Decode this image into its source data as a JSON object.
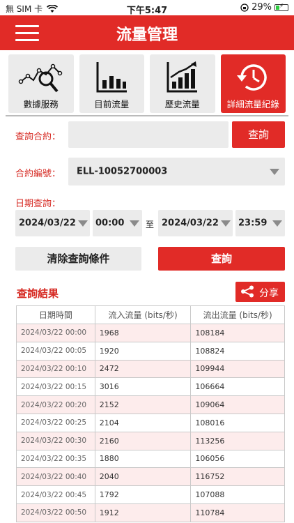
{
  "status_bar": {
    "carrier": "無 SIM 卡",
    "time": "下午5:47",
    "battery": "29%",
    "battery_level": 0.29
  },
  "header": {
    "title": "流量管理"
  },
  "tabs": [
    {
      "label": "數據服務",
      "icon": "analytics-search-icon",
      "active": false
    },
    {
      "label": "目前流量",
      "icon": "bar-chart-icon",
      "active": false
    },
    {
      "label": "歷史流量",
      "icon": "trend-chart-icon",
      "active": false
    },
    {
      "label": "詳細流量紀錄",
      "icon": "history-clock-icon",
      "active": true
    }
  ],
  "form": {
    "contract_query_label": "查詢合約：",
    "contract_query_value": "",
    "contract_query_button": "查詢",
    "contract_no_label": "合約編號：",
    "contract_no_value": "ELL-10052700003",
    "date_query_label": "日期查詢：",
    "start_date": "2024/03/22",
    "start_time": "00:00",
    "to_label": "至",
    "end_date": "2024/03/22",
    "end_time": "23:59",
    "clear_button": "清除查詢條件",
    "query_button": "查詢"
  },
  "results": {
    "title": "查詢結果",
    "share_label": "分享",
    "columns": [
      "日期時間",
      "流入流量 (bits/秒)",
      "流出流量 (bits/秒)"
    ],
    "rows": [
      [
        "2024/03/22 00:00",
        "1968",
        "108184"
      ],
      [
        "2024/03/22 00:05",
        "1920",
        "108824"
      ],
      [
        "2024/03/22 00:10",
        "2472",
        "109944"
      ],
      [
        "2024/03/22 00:15",
        "3016",
        "106664"
      ],
      [
        "2024/03/22 00:20",
        "2152",
        "109064"
      ],
      [
        "2024/03/22 00:25",
        "2104",
        "108016"
      ],
      [
        "2024/03/22 00:30",
        "2160",
        "113256"
      ],
      [
        "2024/03/22 00:35",
        "1880",
        "106056"
      ],
      [
        "2024/03/22 00:40",
        "2040",
        "116752"
      ],
      [
        "2024/03/22 00:45",
        "1792",
        "107088"
      ],
      [
        "2024/03/22 00:50",
        "1912",
        "110784"
      ]
    ]
  },
  "colors": {
    "accent": "#e12b27",
    "label": "#d62a23",
    "field_bg": "#ebebeb",
    "row_tint": "#fdecec"
  }
}
